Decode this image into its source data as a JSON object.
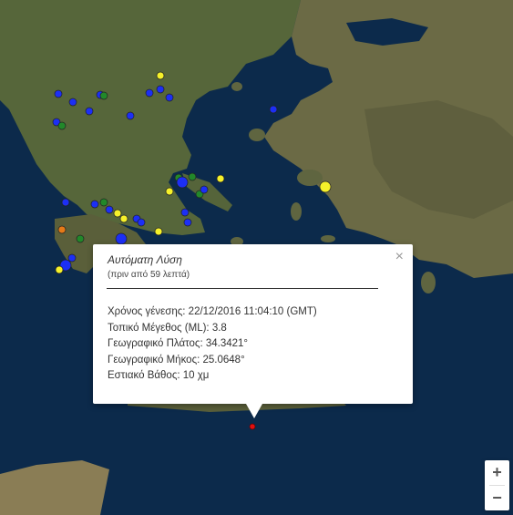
{
  "map": {
    "colors": {
      "sea": "#0b2a4d",
      "land": "#5c6b3a",
      "land_dry": "#7a7350",
      "mountain": "#4a4a35"
    },
    "marker_colors": {
      "blue": "#1c2ff5",
      "green": "#22882a",
      "yellow": "#f6f12a",
      "orange": "#e57a18",
      "red": "#e01010"
    },
    "selected_marker_color": "red"
  },
  "popup": {
    "title": "Αυτόματη Λύση",
    "subtitle": "(πριν από 59 λεπτά)",
    "close_icon": "×",
    "rows": [
      "Χρόνος γένεσης: 22/12/2016  11:04:10 (GMT)",
      "Τοπικό Μέγεθος (ML): 3.8",
      "Γεωγραφικό Πλάτος: 34.3421°",
      "Γεωγραφικό Μήκος: 25.0648°",
      "Εστιακό Βάθος: 10 χμ"
    ]
  },
  "zoom": {
    "in_label": "+",
    "out_label": "−"
  }
}
